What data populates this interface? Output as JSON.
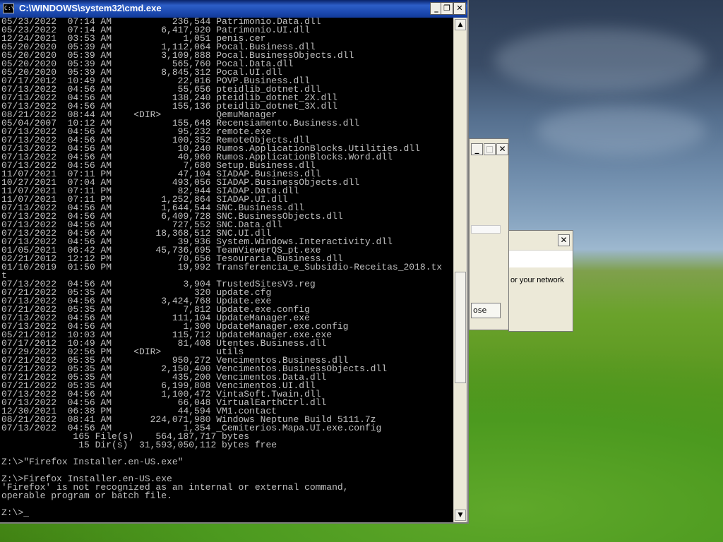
{
  "cmd_window": {
    "title": "C:\\WINDOWS\\system32\\cmd.exe",
    "icon_label": "C:\\",
    "minimize_glyph": "_",
    "maximize_glyph": "❐",
    "close_glyph": "✕",
    "lines": [
      "05/23/2022  07:14 AM           236,544 Patrimonio.Data.dll",
      "05/23/2022  07:14 AM         6,417,920 Patrimonio.UI.dll",
      "12/24/2021  03:53 AM             1,051 penis.cer",
      "05/20/2020  05:39 AM         1,112,064 Pocal.Business.dll",
      "05/20/2020  05:39 AM         3,109,888 Pocal.BusinessObjects.dll",
      "05/20/2020  05:39 AM           565,760 Pocal.Data.dll",
      "05/20/2020  05:39 AM         8,845,312 Pocal.UI.dll",
      "07/17/2012  10:49 AM            22,016 POVP.Business.dll",
      "07/13/2022  04:56 AM            55,656 pteidlib_dotnet.dll",
      "07/13/2022  04:56 AM           138,240 pteidlib_dotnet_2X.dll",
      "07/13/2022  04:56 AM           155,136 pteidlib_dotnet_3X.dll",
      "08/21/2022  08:44 AM    <DIR>          QemuManager",
      "05/04/2007  10:12 AM           155,648 Recensiamento.Business.dll",
      "07/13/2022  04:56 AM            95,232 remote.exe",
      "07/13/2022  04:56 AM           100,352 RemoteObjects.dll",
      "07/13/2022  04:56 AM            10,240 Rumos.ApplicationBlocks.Utilities.dll",
      "07/13/2022  04:56 AM            40,960 Rumos.ApplicationBlocks.Word.dll",
      "07/13/2022  04:56 AM             7,680 Setup.Business.dll",
      "11/07/2021  07:11 PM            47,104 SIADAP.Business.dll",
      "10/27/2021  07:04 AM           493,056 SIADAP.BusinessObjects.dll",
      "11/07/2021  07:11 PM            82,944 SIADAP.Data.dll",
      "11/07/2021  07:11 PM         1,252,864 SIADAP.UI.dll",
      "07/13/2022  04:56 AM         1,644,544 SNC.Business.dll",
      "07/13/2022  04:56 AM         6,409,728 SNC.BusinessObjects.dll",
      "07/13/2022  04:56 AM           727,552 SNC.Data.dll",
      "07/13/2022  04:56 AM        18,368,512 SNC.UI.dll",
      "07/13/2022  04:56 AM            39,936 System.Windows.Interactivity.dll",
      "01/05/2021  06:42 AM        45,736,695 TeamViewerQS_pt.exe",
      "02/21/2012  12:12 PM            70,656 Tesouraria.Business.dll",
      "01/10/2019  01:50 PM            19,992 Transferencia_e_Subsidio-Receitas_2018.tx",
      "t",
      "07/13/2022  04:56 AM             3,904 TrustedSitesV3.reg",
      "07/21/2022  05:35 AM               320 update.cfg",
      "07/13/2022  04:56 AM         3,424,768 Update.exe",
      "07/21/2022  05:35 AM             7,812 Update.exe.config",
      "07/13/2022  04:56 AM           111,104 UpdateManager.exe",
      "07/13/2022  04:56 AM             1,300 UpdateManager.exe.config",
      "05/21/2012  10:03 AM           115,712 UpdateManager.exe.exe",
      "07/17/2012  10:49 AM            81,408 Utentes.Business.dll",
      "07/29/2022  02:56 PM    <DIR>          utils",
      "07/21/2022  05:35 AM           950,272 Vencimentos.Business.dll",
      "07/21/2022  05:35 AM         2,150,400 Vencimentos.BusinessObjects.dll",
      "07/21/2022  05:35 AM           435,200 Vencimentos.Data.dll",
      "07/21/2022  05:35 AM         6,199,808 Vencimentos.UI.dll",
      "07/13/2022  04:56 AM         1,100,472 VintaSoft.Twain.dll",
      "07/13/2022  04:56 AM            66,048 VirtualEarthCtrl.dll",
      "12/30/2021  06:38 PM            44,594 VM1.contact",
      "08/21/2022  08:41 AM       224,071,980 Windows Neptune Build 5111.7z",
      "07/13/2022  04:56 AM             1,354 _Cemiterios.Mapa.UI.exe.config",
      "             165 File(s)    564,187,717 bytes",
      "              15 Dir(s)  31,593,050,112 bytes free",
      "",
      "Z:\\>\"Firefox Installer.en-US.exe\"",
      "",
      "Z:\\>Firefox Installer.en-US.exe",
      "'Firefox' is not recognized as an internal or external command,",
      "operable program or batch file.",
      "",
      "Z:\\>_"
    ]
  },
  "dialog_back": {
    "minimize_glyph": "_",
    "maximize_glyph": "□",
    "close_glyph": "✕",
    "button_label": "ose"
  },
  "dialog_front": {
    "close_glyph": "✕",
    "text": "or your network"
  }
}
